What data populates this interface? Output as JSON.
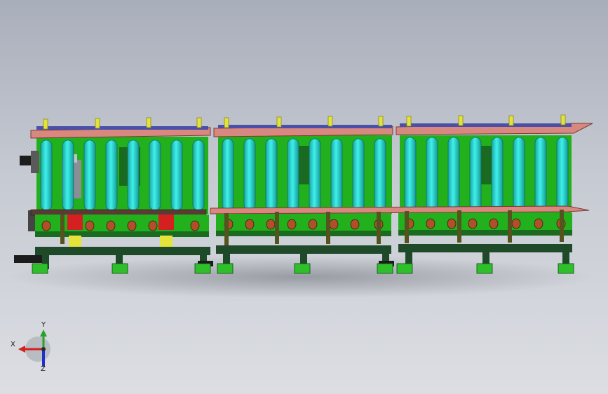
{
  "triad": {
    "x_label": "X",
    "y_label": "Y",
    "z_label": "Z",
    "x_color": "#d42020",
    "y_color": "#2aa02a",
    "z_color": "#1f2fc8"
  },
  "model": {
    "frame_color": "#20b81c",
    "base_color": "#1f4a2a",
    "roller_color": "#29d6d0",
    "top_rail_color": "#d98880",
    "top_plate_color": "#4a4fa8",
    "pin_color": "#e3e33a",
    "bearing_color": "#b0502a"
  }
}
